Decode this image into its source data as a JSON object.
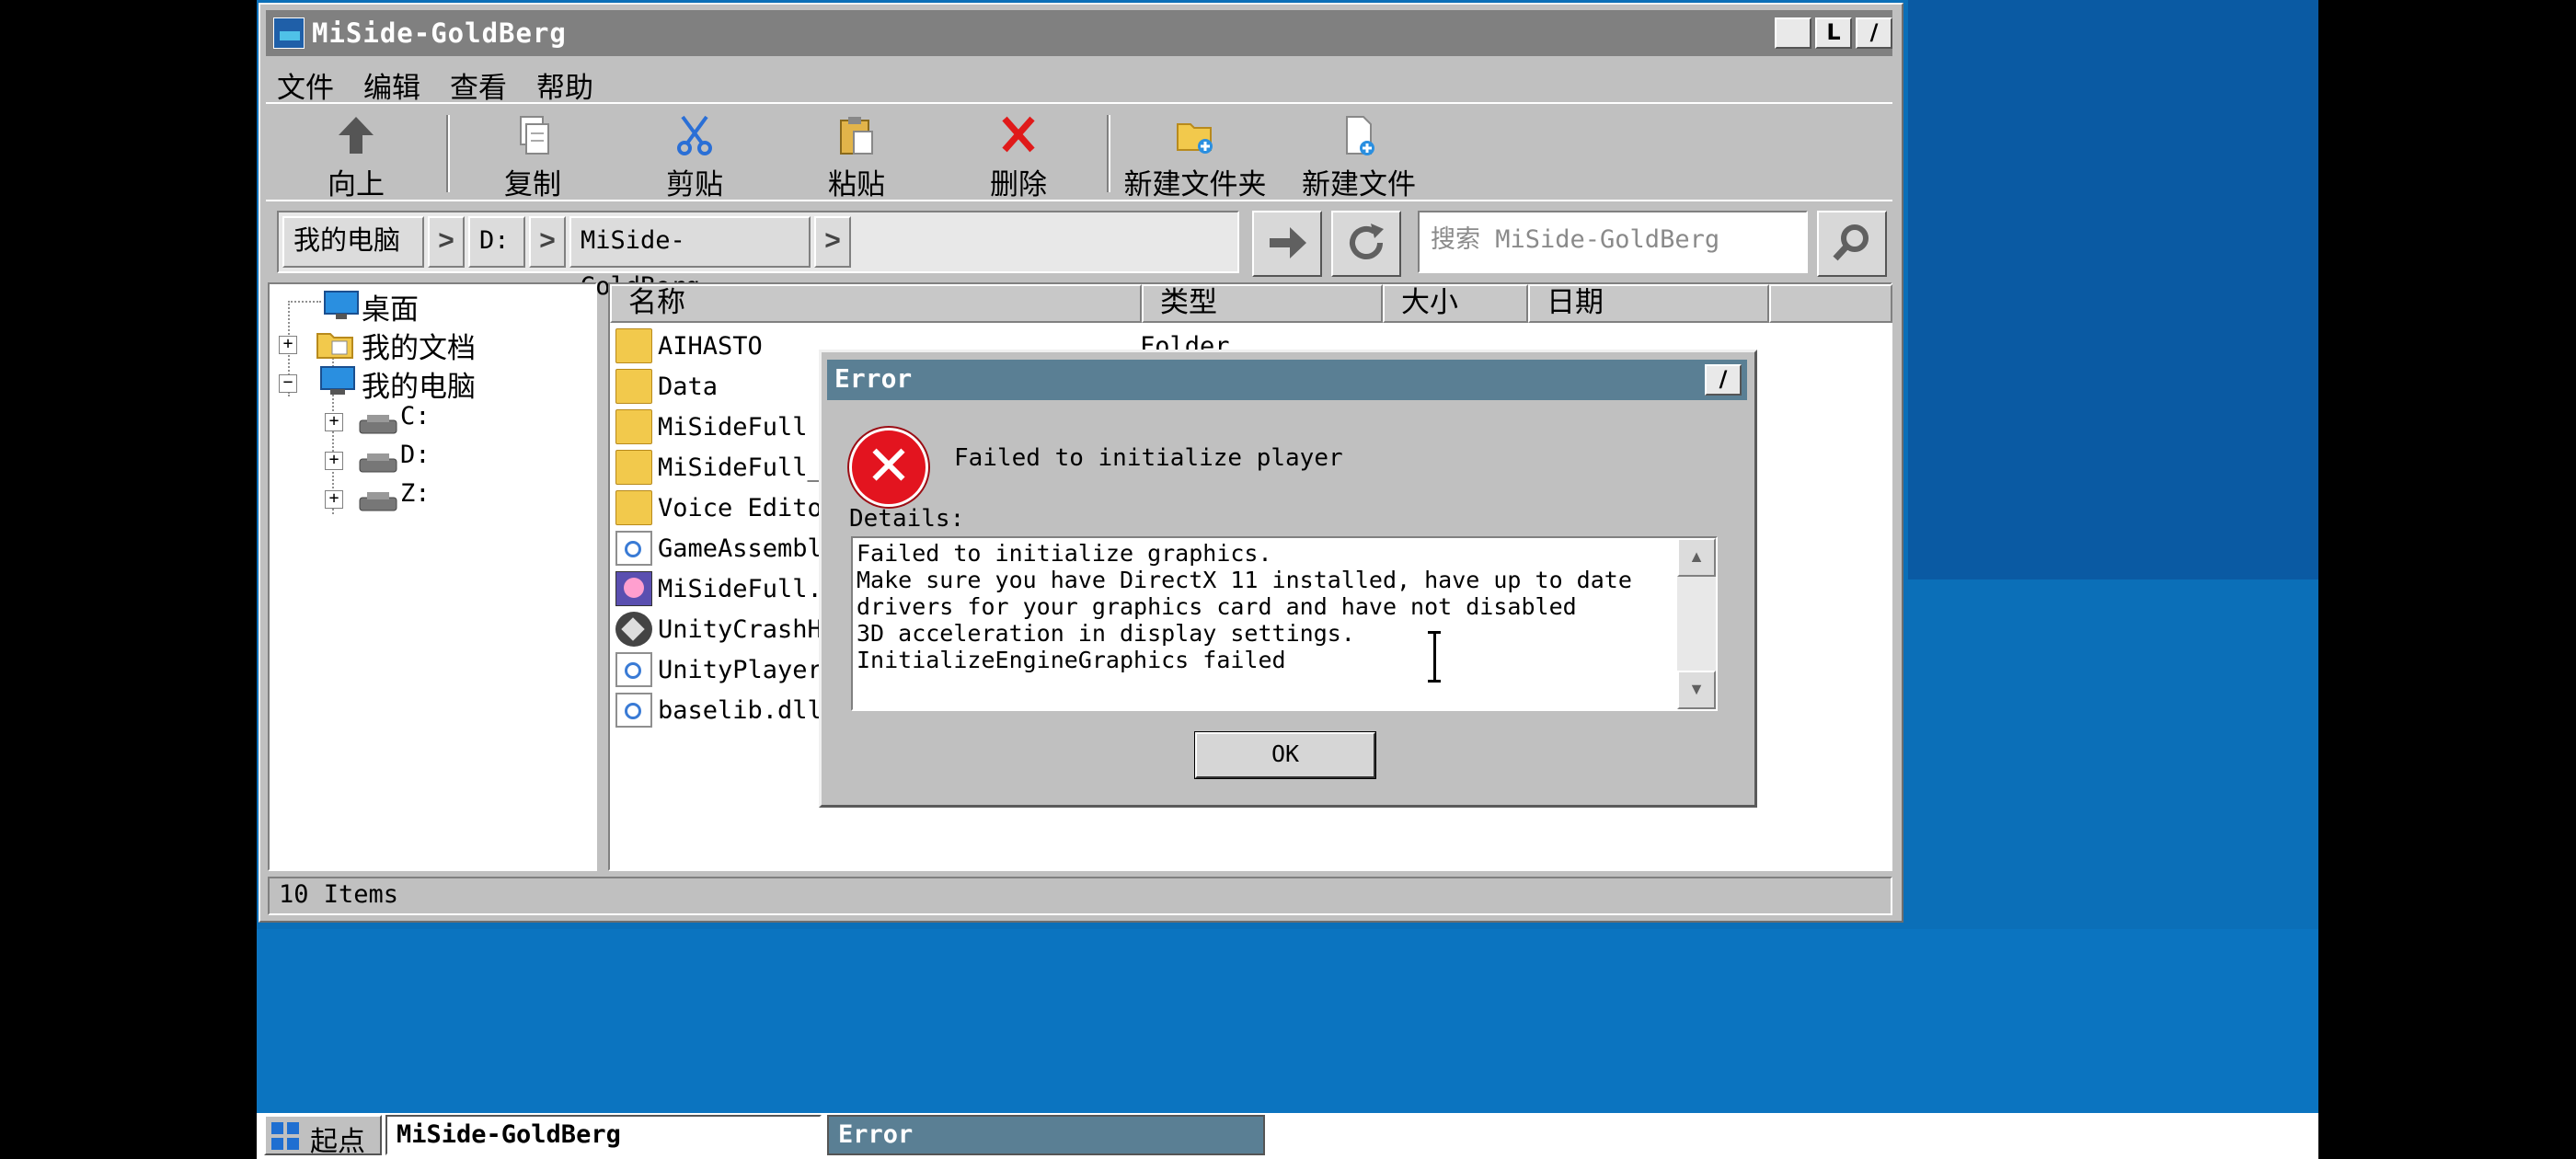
{
  "window": {
    "title": "MiSide-GoldBerg",
    "controls": {
      "minimize": "",
      "maximize": "L",
      "close": "/"
    }
  },
  "menu": [
    "文件",
    "编辑",
    "查看",
    "帮助"
  ],
  "toolbar": {
    "up": "向上",
    "copy": "复制",
    "cut": "剪贴",
    "paste": "粘贴",
    "delete": "删除",
    "new_folder": "新建文件夹",
    "new_file": "新建文件"
  },
  "address": {
    "crumbs": [
      "我的电脑",
      "D:",
      "MiSide-GoldBerg"
    ],
    "arrow": ">",
    "search_placeholder": "搜索 MiSide-GoldBerg"
  },
  "tree": {
    "desktop": "桌面",
    "documents": "我的文档",
    "computer": "我的电脑",
    "drives": [
      "C:",
      "D:",
      "Z:"
    ]
  },
  "columns": {
    "name": "名称",
    "type": "类型",
    "size": "大小",
    "date": "日期"
  },
  "files": [
    {
      "name": "AIHASTO",
      "type": "Folder",
      "icon": "folder-icon"
    },
    {
      "name": "Data",
      "type": "",
      "icon": "folder-icon"
    },
    {
      "name": "MiSideFull",
      "type": "",
      "icon": "folder-icon"
    },
    {
      "name": "MiSideFull_",
      "type": "",
      "icon": "folder-icon"
    },
    {
      "name": "Voice Edito",
      "type": "",
      "icon": "folder-icon"
    },
    {
      "name": "GameAssembl",
      "type": "",
      "icon": "dll-file-icon"
    },
    {
      "name": "MiSideFull.",
      "type": "",
      "icon": "game-exe-icon"
    },
    {
      "name": "UnityCrashH",
      "type": "",
      "icon": "unity-icon"
    },
    {
      "name": "UnityPlayer",
      "type": "",
      "icon": "dll-file-icon"
    },
    {
      "name": "baselib.dll",
      "type": "",
      "icon": "dll-file-icon"
    }
  ],
  "status": "10 Items",
  "dialog": {
    "title": "Error",
    "close": "/",
    "message": "Failed to initialize player",
    "details_label": "Details:",
    "details_lines": [
      "Failed to initialize graphics.",
      "Make sure you have DirectX 11 installed, have up to date",
      "drivers for your graphics card and have not disabled",
      "3D acceleration in display settings.",
      "InitializeEngineGraphics failed"
    ],
    "ok": "OK"
  },
  "taskbar": {
    "start": "起点",
    "tasks": [
      "MiSide-GoldBerg",
      "Error"
    ]
  },
  "colors": {
    "title_inactive": "#808080",
    "title_active": "#5a7f94",
    "desktop": "#0b6fb8",
    "error_red": "#e3141f"
  }
}
